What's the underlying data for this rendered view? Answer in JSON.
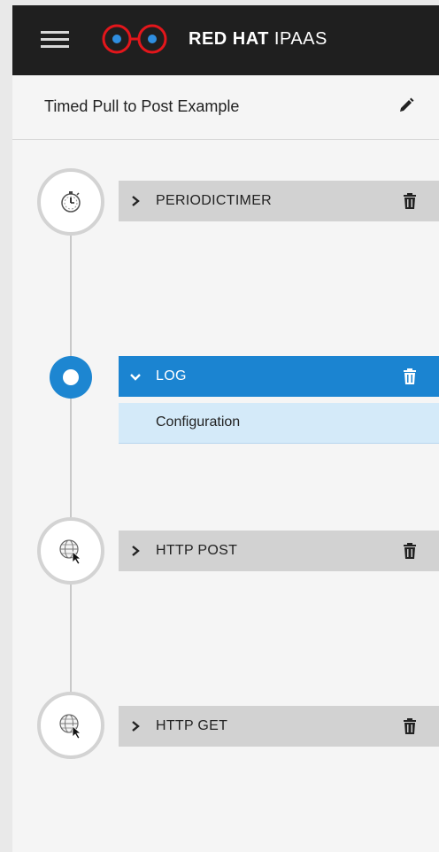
{
  "header": {
    "menu_icon": "hamburger-menu-icon",
    "logo_icon": "red-hat-glasses-logo",
    "brand_bold": "RED HAT",
    "brand_light": "IPAAS",
    "background": "#1f1f1f"
  },
  "flow": {
    "title": "Timed Pull to Post Example",
    "edit_icon": "pencil-icon"
  },
  "steps": [
    {
      "label": "PERIODICTIMER",
      "icon": "timer-icon",
      "expanded": false
    },
    {
      "label": "LOG",
      "icon": "active-step-dot",
      "expanded": true,
      "sub_items": [
        "Configuration"
      ]
    },
    {
      "label": "HTTP POST",
      "icon": "globe-cursor-icon",
      "expanded": false
    },
    {
      "label": "HTTP GET",
      "icon": "globe-cursor-icon",
      "expanded": false
    }
  ],
  "colors": {
    "accent": "#1b84d1",
    "step_bg": "#d2d2d2",
    "sub_panel_bg": "#d4eaf9"
  }
}
